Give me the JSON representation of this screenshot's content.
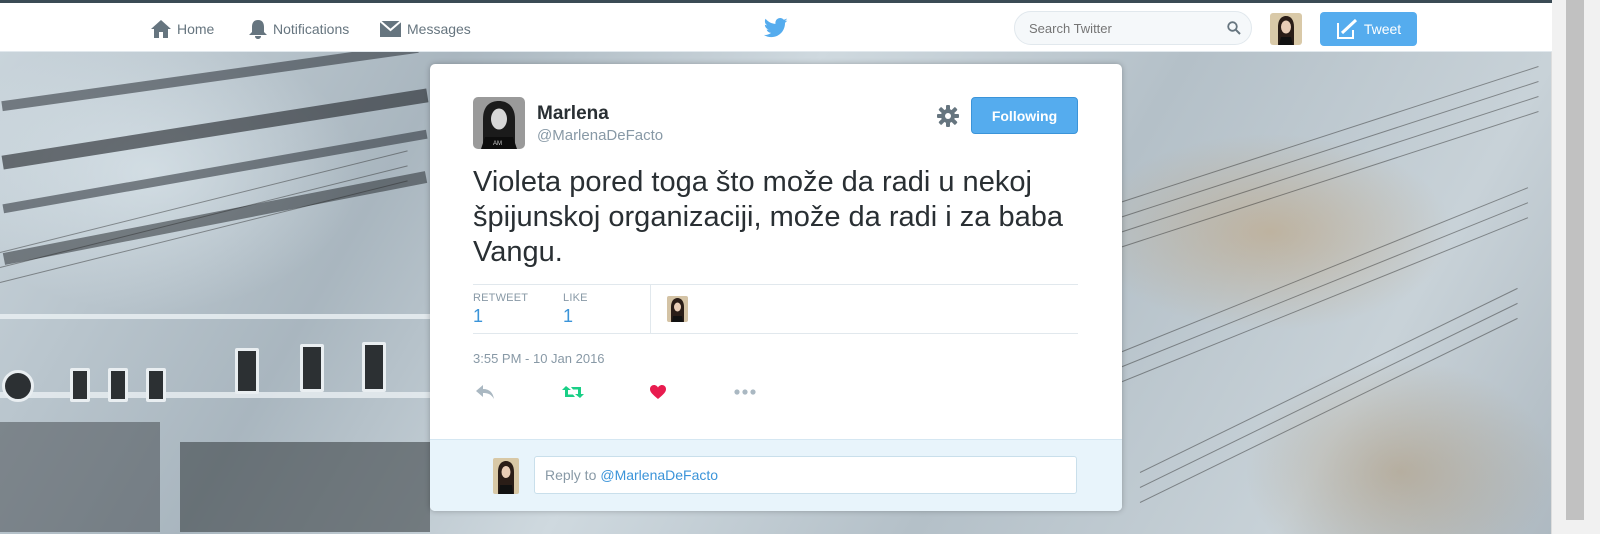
{
  "nav": {
    "home_label": "Home",
    "notifications_label": "Notifications",
    "messages_label": "Messages",
    "search_placeholder": "Search Twitter",
    "tweet_button_label": "Tweet",
    "icons": [
      "home-icon",
      "bell-icon",
      "envelope-icon",
      "twitter-bird-icon",
      "search-icon",
      "compose-icon"
    ]
  },
  "tweet": {
    "author_name": "Marlena",
    "author_handle": "@MarlenaDeFacto",
    "follow_label": "Following",
    "text": "Violeta pored toga što može da radi u nekoj špijunskoj organizaciji, može da radi i za baba Vangu.",
    "retweets_label": "RETWEET",
    "retweets_count": "1",
    "likes_label": "LIKE",
    "likes_count": "1",
    "timestamp": "3:55 PM - 10 Jan 2016",
    "actions": [
      "reply-icon",
      "retweet-icon",
      "heart-icon",
      "more-icon"
    ]
  },
  "reply": {
    "prefix": "Reply to",
    "mention": "@MarlenaDeFacto"
  },
  "colors": {
    "brand_blue": "#55acee",
    "link_blue": "#3b94d9",
    "retweet_green": "#19cf86",
    "like_red": "#e81c4f",
    "muted_gray": "#8899a6"
  }
}
